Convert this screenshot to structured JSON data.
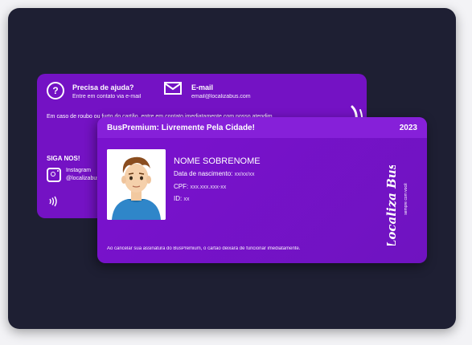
{
  "back_card": {
    "help_title": "Precisa de ajuda?",
    "help_sub": "Entre em contato via e-mail",
    "email_title": "E-mail",
    "email_value": "email@localizabus.com",
    "theft_note": "Em caso de roubo ou furto do cartão, entre em contato imediatamente com nosso atendim",
    "follow_label": "SIGA NOS!",
    "instagram_label": "Instagram",
    "instagram_handle": "@localizabus"
  },
  "front_card": {
    "slogan": "BusPremium: Livremente Pela Cidade!",
    "year": "2023",
    "name": "NOME SOBRENOME",
    "dob_label": "Data de nascimento:",
    "dob_value": "xx/xx/xx",
    "cpf_label": "CPF:",
    "cpf_value": "xxx.xxx.xxx-xx",
    "id_label": "ID:",
    "id_value": "xx",
    "footer_note": "Ao cancelar sua assinatura do BusPremium, o cartão deixará de funcionar imediatamente.",
    "brand_name": "Localiza Bus",
    "brand_tagline": "sempre com você"
  },
  "icons": [
    "question-icon",
    "mail-icon",
    "instagram-icon",
    "nfc-icon"
  ],
  "colors": {
    "panel_bg": "#1e1f33",
    "card_purple": "#7412c4",
    "header_purple": "#8620d9",
    "text": "#ffffff"
  }
}
